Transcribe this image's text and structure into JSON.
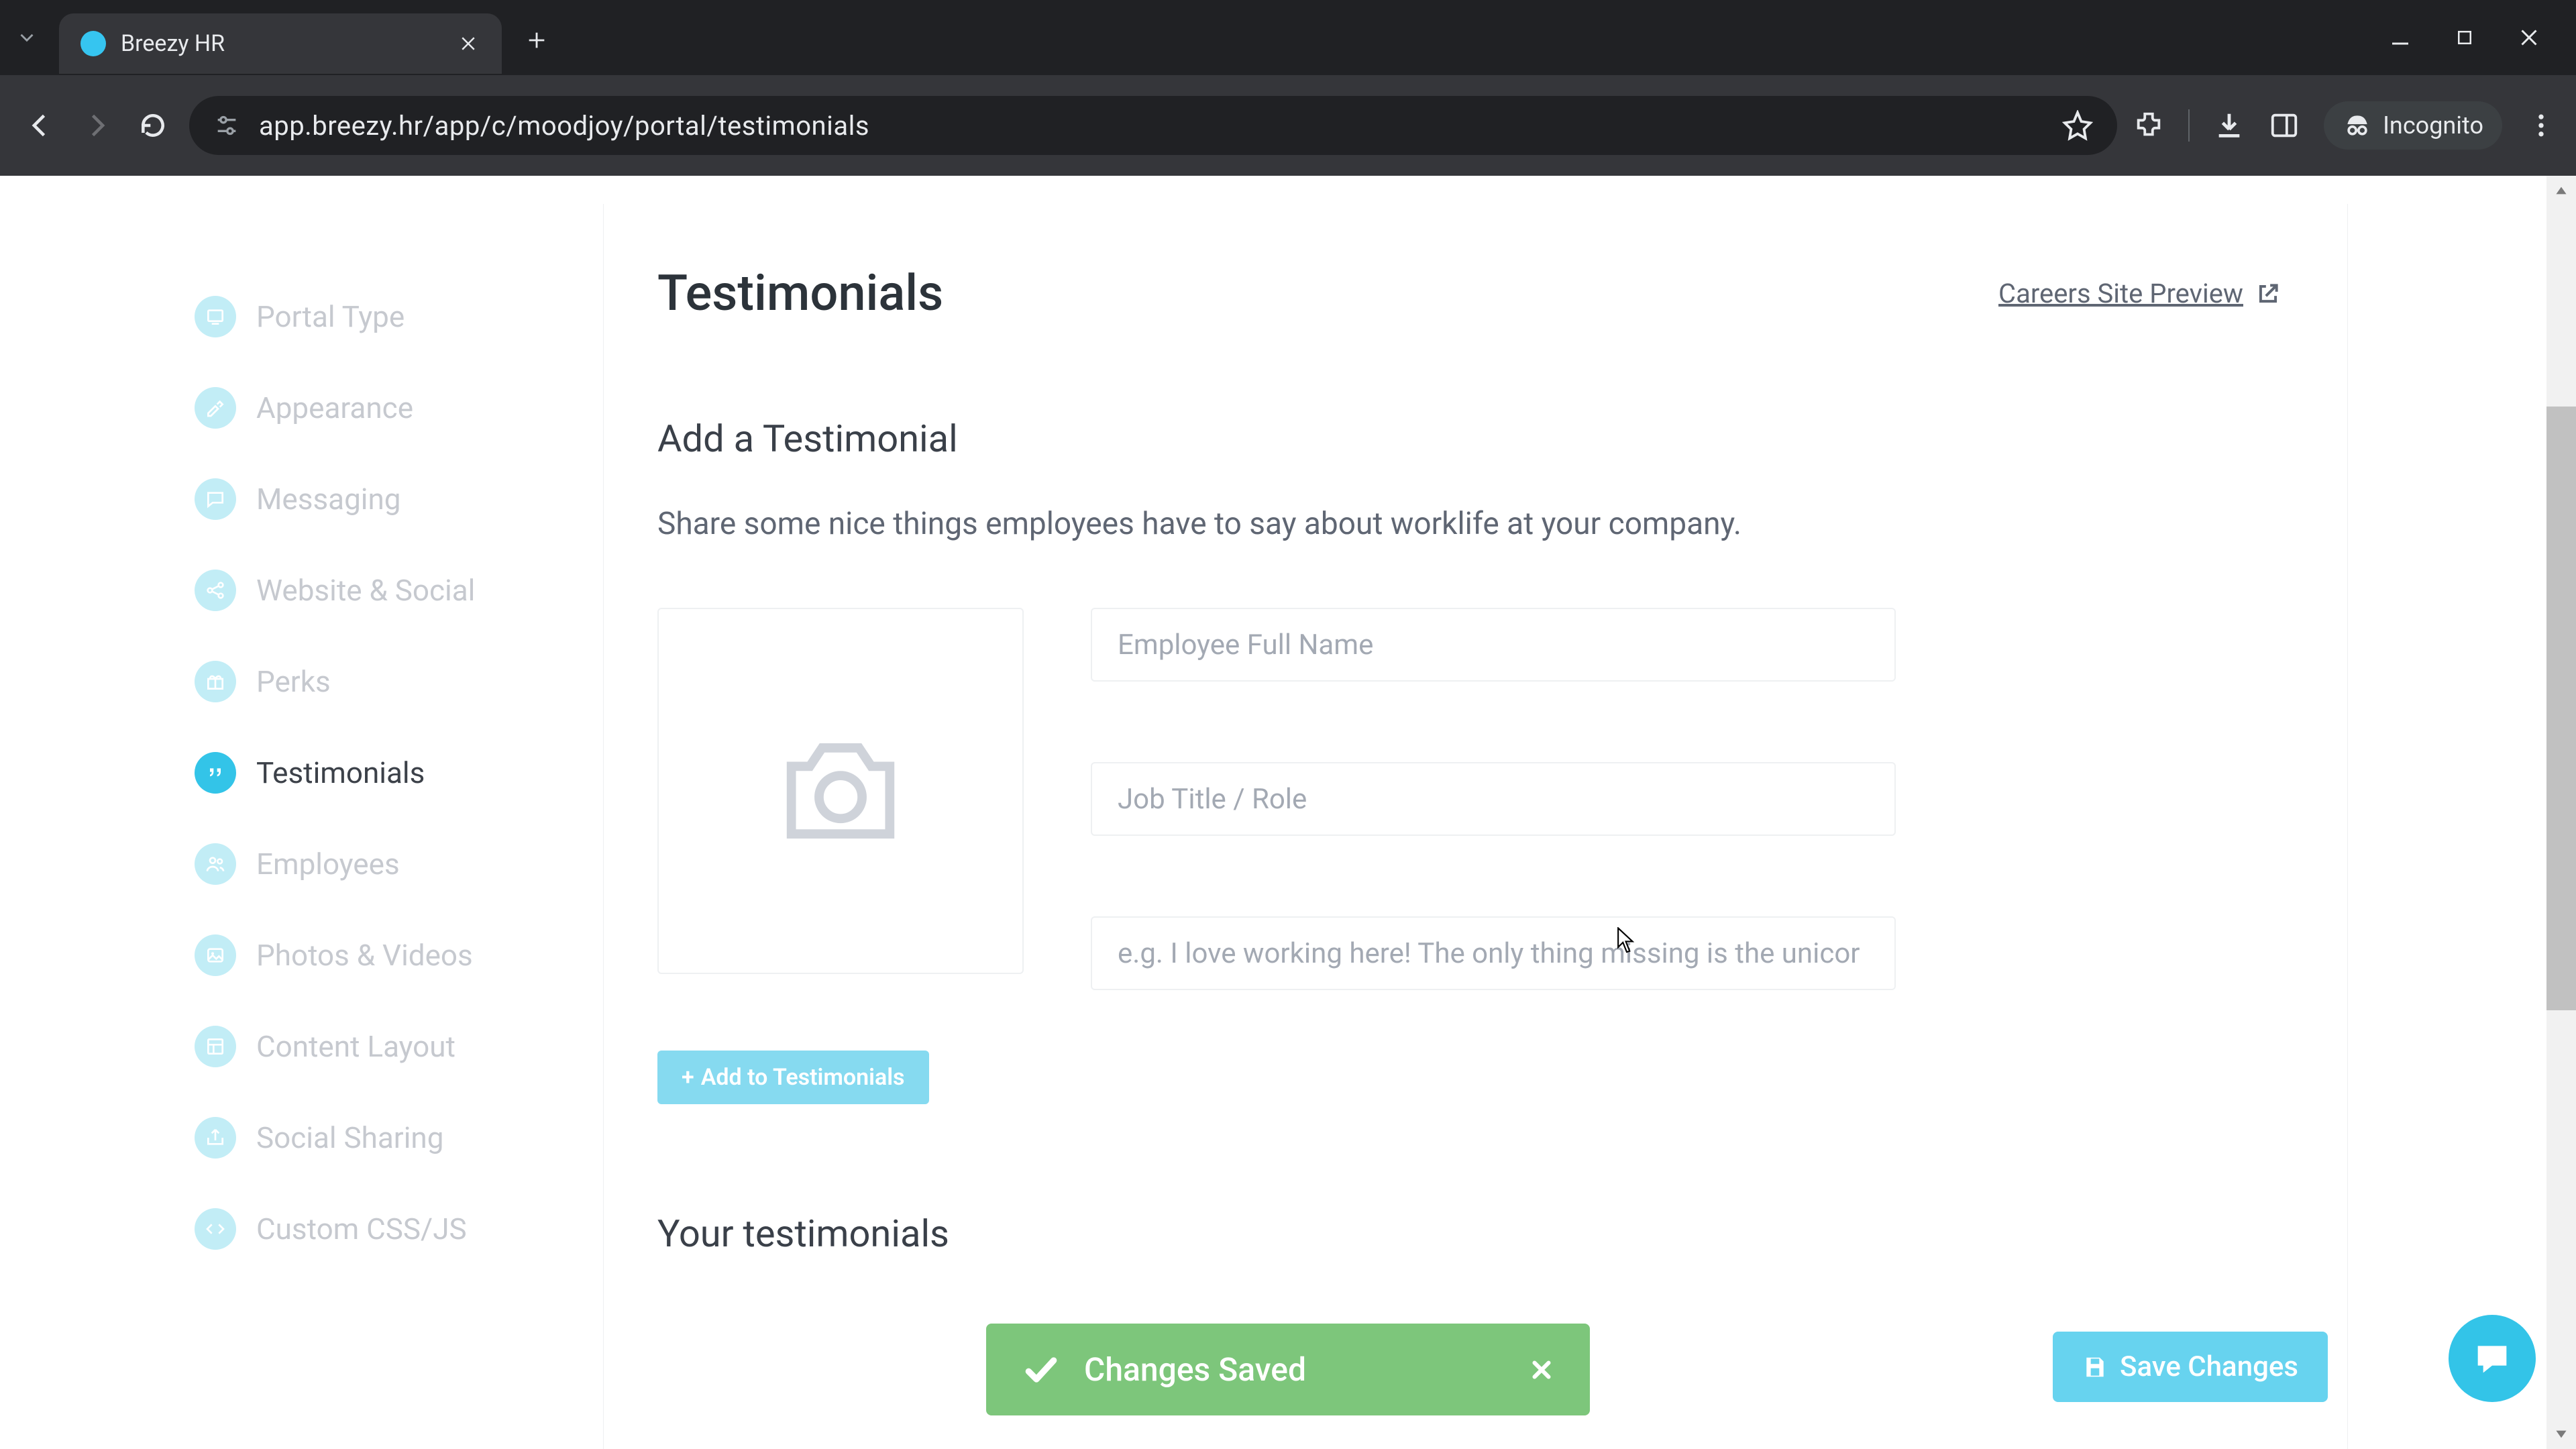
{
  "browser": {
    "tab_title": "Breezy HR",
    "url": "app.breezy.hr/app/c/moodjoy/portal/testimonials",
    "incognito_label": "Incognito"
  },
  "sidebar": {
    "items": [
      {
        "label": "Portal Type",
        "active": false
      },
      {
        "label": "Appearance",
        "active": false
      },
      {
        "label": "Messaging",
        "active": false
      },
      {
        "label": "Website & Social",
        "active": false
      },
      {
        "label": "Perks",
        "active": false
      },
      {
        "label": "Testimonials",
        "active": true
      },
      {
        "label": "Employees",
        "active": false
      },
      {
        "label": "Photos & Videos",
        "active": false
      },
      {
        "label": "Content Layout",
        "active": false
      },
      {
        "label": "Social Sharing",
        "active": false
      },
      {
        "label": "Custom CSS/JS",
        "active": false
      }
    ]
  },
  "header": {
    "title": "Testimonials",
    "preview_label": "Careers Site Preview"
  },
  "section": {
    "title": "Add a Testimonial",
    "description": "Share some nice things employees have to say about worklife at your company.",
    "name_placeholder": "Employee Full Name",
    "role_placeholder": "Job Title / Role",
    "quote_placeholder": "e.g. I love working here! The only thing missing is the unicor",
    "add_button": "Add to Testimonials",
    "your_testimonials_title": "Your testimonials"
  },
  "toast": {
    "message": "Changes Saved"
  },
  "buttons": {
    "save_changes": "Save Changes"
  },
  "colors": {
    "accent": "#33c4e8",
    "accent_light": "#86daf0",
    "success": "#7dc67b",
    "sidebar_inactive": "#c2edf6"
  }
}
